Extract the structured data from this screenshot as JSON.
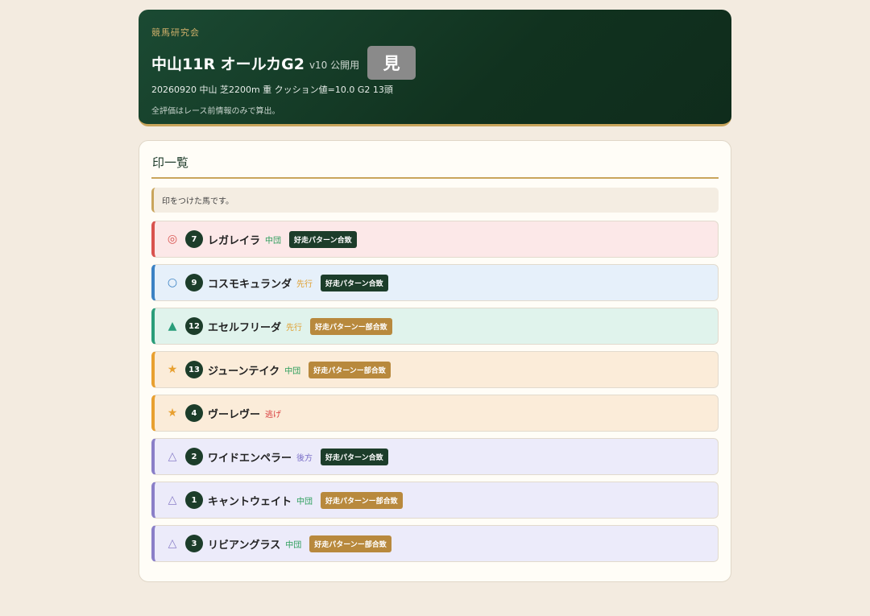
{
  "header": {
    "org": "競馬研究会",
    "title": "中山11R オールカG2",
    "version": "v10 公開用",
    "view_button": "見",
    "meta": "20260920 中山 芝2200m 重 クッション値=10.0 G2 13頭",
    "note": "全評価はレース前情報のみで算出。"
  },
  "panel": {
    "title": "印一覧",
    "description": "印をつけた馬です。"
  },
  "colors": {
    "honmei": "#d9534f",
    "taikou": "#3b82c4",
    "tanana": "#2a9d7a",
    "star": "#e8a030",
    "renka": "#8a7fc8",
    "style_chudan": "#2a9d5a",
    "style_senkou": "#e0a030",
    "style_nige": "#d94040",
    "style_kouhou": "#7a6fc8"
  },
  "horses": [
    {
      "mark": "◎",
      "num": "7",
      "name": "レガレイラ",
      "style": "中団",
      "badge": "好走パターン合致",
      "kind": "honmei"
    },
    {
      "mark": "○",
      "num": "9",
      "name": "コスモキュランダ",
      "style": "先行",
      "badge": "好走パターン合致",
      "kind": "taikou"
    },
    {
      "mark": "▲",
      "num": "12",
      "name": "エセルフリーダ",
      "style": "先行",
      "badge": "好走パターンー部合致",
      "kind": "tanana"
    },
    {
      "mark": "★",
      "num": "13",
      "name": "ジューンテイク",
      "style": "中団",
      "badge": "好走パターンー部合致",
      "kind": "star"
    },
    {
      "mark": "★",
      "num": "4",
      "name": "ヴーレヴー",
      "style": "逃げ",
      "badge": "",
      "kind": "star"
    },
    {
      "mark": "△",
      "num": "2",
      "name": "ワイドエンペラー",
      "style": "後方",
      "badge": "好走パターン合致",
      "kind": "renka"
    },
    {
      "mark": "△",
      "num": "1",
      "name": "キャントウェイト",
      "style": "中団",
      "badge": "好走パターンー部合致",
      "kind": "renka"
    },
    {
      "mark": "△",
      "num": "3",
      "name": "リビアングラス",
      "style": "中団",
      "badge": "好走パターンー部合致",
      "kind": "renka"
    }
  ]
}
